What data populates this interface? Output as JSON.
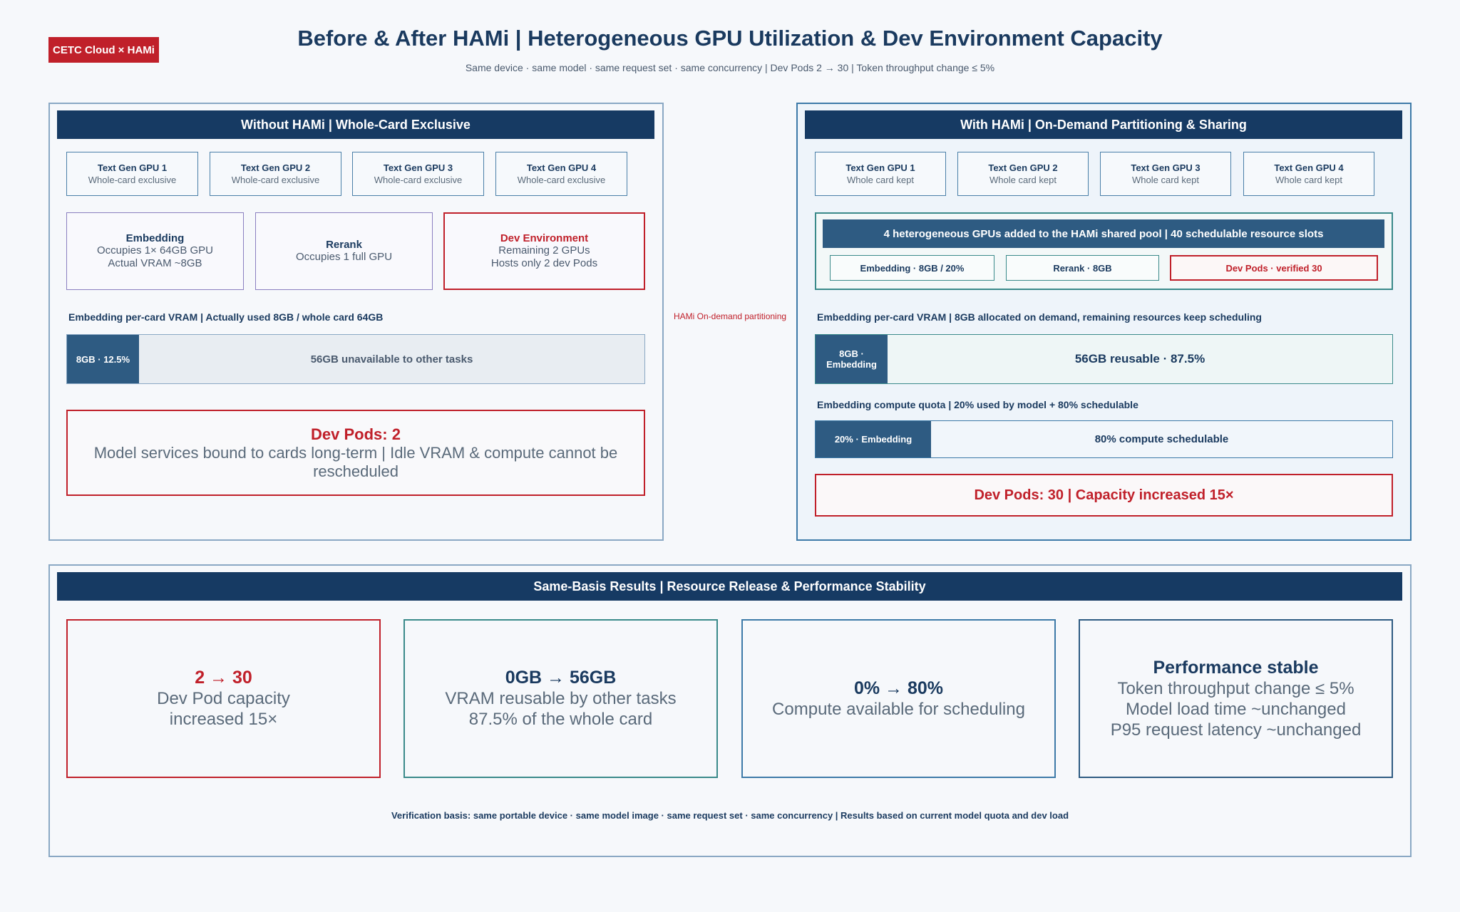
{
  "badge": "CETC Cloud × HAMi",
  "title": "Before & After HAMi | Heterogeneous GPU Utilization & Dev Environment Capacity",
  "subtitle": "Same device · same model · same request set · same concurrency | Dev Pods 2 → 30 | Token throughput change ≤ 5%",
  "left": {
    "header": "Without HAMi | Whole-Card Exclusive",
    "gpus": [
      {
        "title": "Text Gen GPU 1",
        "sub": "Whole-card exclusive"
      },
      {
        "title": "Text Gen GPU 2",
        "sub": "Whole-card exclusive"
      },
      {
        "title": "Text Gen GPU 3",
        "sub": "Whole-card exclusive"
      },
      {
        "title": "Text Gen GPU 4",
        "sub": "Whole-card exclusive"
      }
    ],
    "services": [
      {
        "title": "Embedding",
        "line1": "Occupies 1× 64GB GPU",
        "line2": "Actual VRAM ~8GB"
      },
      {
        "title": "Rerank",
        "line1": "Occupies 1 full GPU",
        "line2": ""
      },
      {
        "title": "Dev Environment",
        "line1": "Remaining 2 GPUs",
        "line2": "Hosts only 2 dev Pods"
      }
    ],
    "vram_label": "Embedding per-card VRAM | Actually used 8GB / whole card 64GB",
    "vram_used": "8GB · 12.5%",
    "vram_rest": "56GB unavailable to other tasks",
    "vram_used_fraction": 0.125,
    "pods_title": "Dev Pods: 2",
    "pods_desc": "Model services bound to cards long-term | Idle VRAM & compute cannot be rescheduled"
  },
  "middle_label": "HAMi On-demand partitioning",
  "right": {
    "header": "With HAMi | On-Demand Partitioning & Sharing",
    "gpus": [
      {
        "title": "Text Gen GPU 1",
        "sub": "Whole card kept"
      },
      {
        "title": "Text Gen GPU 2",
        "sub": "Whole card kept"
      },
      {
        "title": "Text Gen GPU 3",
        "sub": "Whole card kept"
      },
      {
        "title": "Text Gen GPU 4",
        "sub": "Whole card kept"
      }
    ],
    "pool_header": "4 heterogeneous GPUs added to the HAMi shared pool | 40 schedulable resource slots",
    "pool_items": [
      "Embedding · 8GB / 20%",
      "Rerank · 8GB",
      "Dev Pods · verified 30"
    ],
    "vram_label": "Embedding per-card VRAM | 8GB allocated on demand, remaining resources keep scheduling",
    "vram_used_l1": "8GB ·",
    "vram_used_l2": "Embedding",
    "vram_rest": "56GB reusable · 87.5%",
    "vram_used_fraction": 0.125,
    "compute_label": "Embedding compute quota | 20% used by model + 80% schedulable",
    "compute_used": "20% · Embedding",
    "compute_rest": "80% compute schedulable",
    "compute_used_fraction": 0.2,
    "pods": "Dev Pods: 30 | Capacity increased 15×"
  },
  "bottom": {
    "header": "Same-Basis Results | Resource Release & Performance Stability",
    "kpis": [
      {
        "big": "2 → 30",
        "l1": "Dev Pod capacity",
        "l2": "increased 15×",
        "l3": ""
      },
      {
        "big": "0GB → 56GB",
        "l1": "VRAM reusable by other tasks",
        "l2": "87.5% of the whole card",
        "l3": ""
      },
      {
        "big": "0% → 80%",
        "l1": "Compute available for scheduling",
        "l2": "",
        "l3": ""
      },
      {
        "big": "Performance stable",
        "l1": "Token throughput change ≤ 5%",
        "l2": "Model load time ~unchanged",
        "l3": "P95 request latency ~unchanged"
      }
    ],
    "footnote": "Verification basis: same portable device · same model image · same request set · same concurrency | Results based on current model quota and dev load"
  },
  "colors": {
    "navy": "#163a63",
    "red": "#c0202a",
    "teal": "#3a8a8a",
    "steel": "#2e5b82"
  }
}
